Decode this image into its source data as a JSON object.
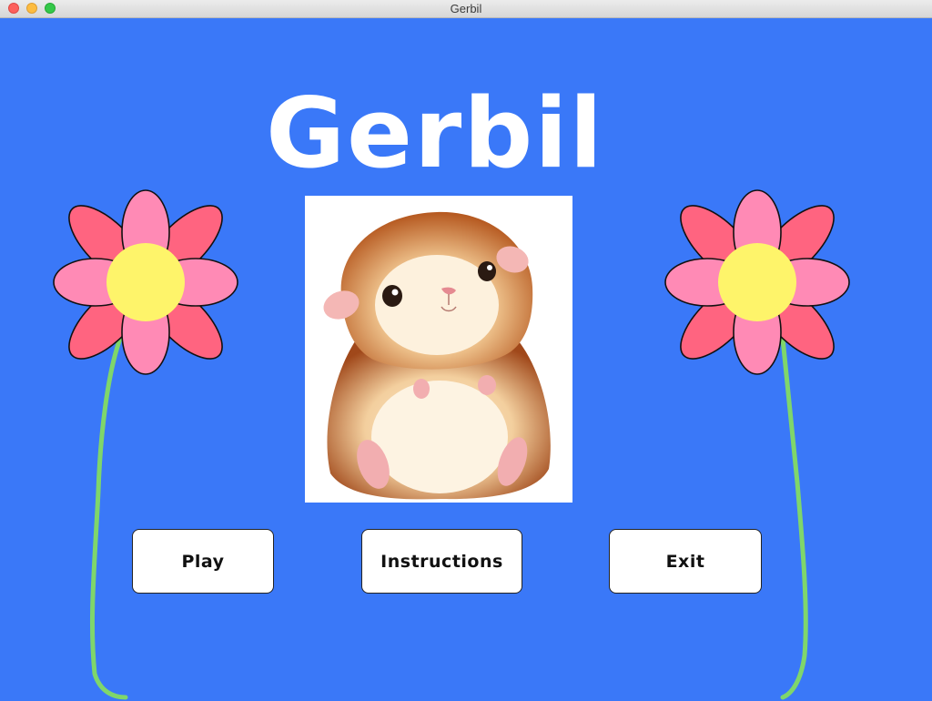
{
  "window": {
    "title": "Gerbil"
  },
  "main": {
    "heading": "Gerbil",
    "picture": {
      "subject": "gerbil-illustration"
    },
    "buttons": [
      {
        "label": "Play"
      },
      {
        "label": "Instructions"
      },
      {
        "label": "Exit"
      }
    ]
  },
  "colors": {
    "background": "#3a78f8",
    "petal_dark": "#ff6480",
    "petal_light": "#ff8ab5",
    "flower_center": "#fef46a",
    "stem": "#7fd66b",
    "button_bg": "#ffffff",
    "heading_text": "#ffffff"
  },
  "icons": [
    "close-icon",
    "minimize-icon",
    "maximize-icon"
  ]
}
